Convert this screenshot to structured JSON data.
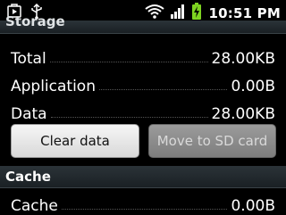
{
  "status_bar": {
    "time": "10:51 PM",
    "left_icons": [
      "play-store-icon",
      "usb-icon"
    ],
    "right_icons": [
      "wifi-icon",
      "signal-icon",
      "battery-charging-icon"
    ],
    "battery_color": "#7ed321"
  },
  "storage": {
    "header": "Storage",
    "rows": [
      {
        "label": "Total",
        "value": "28.00KB"
      },
      {
        "label": "Application",
        "value": "0.00B"
      },
      {
        "label": "Data",
        "value": "28.00KB"
      }
    ],
    "clear_button": "Clear data",
    "move_button": "Move to SD card"
  },
  "cache": {
    "header": "Cache",
    "rows": [
      {
        "label": "Cache",
        "value": "0.00B"
      }
    ]
  }
}
